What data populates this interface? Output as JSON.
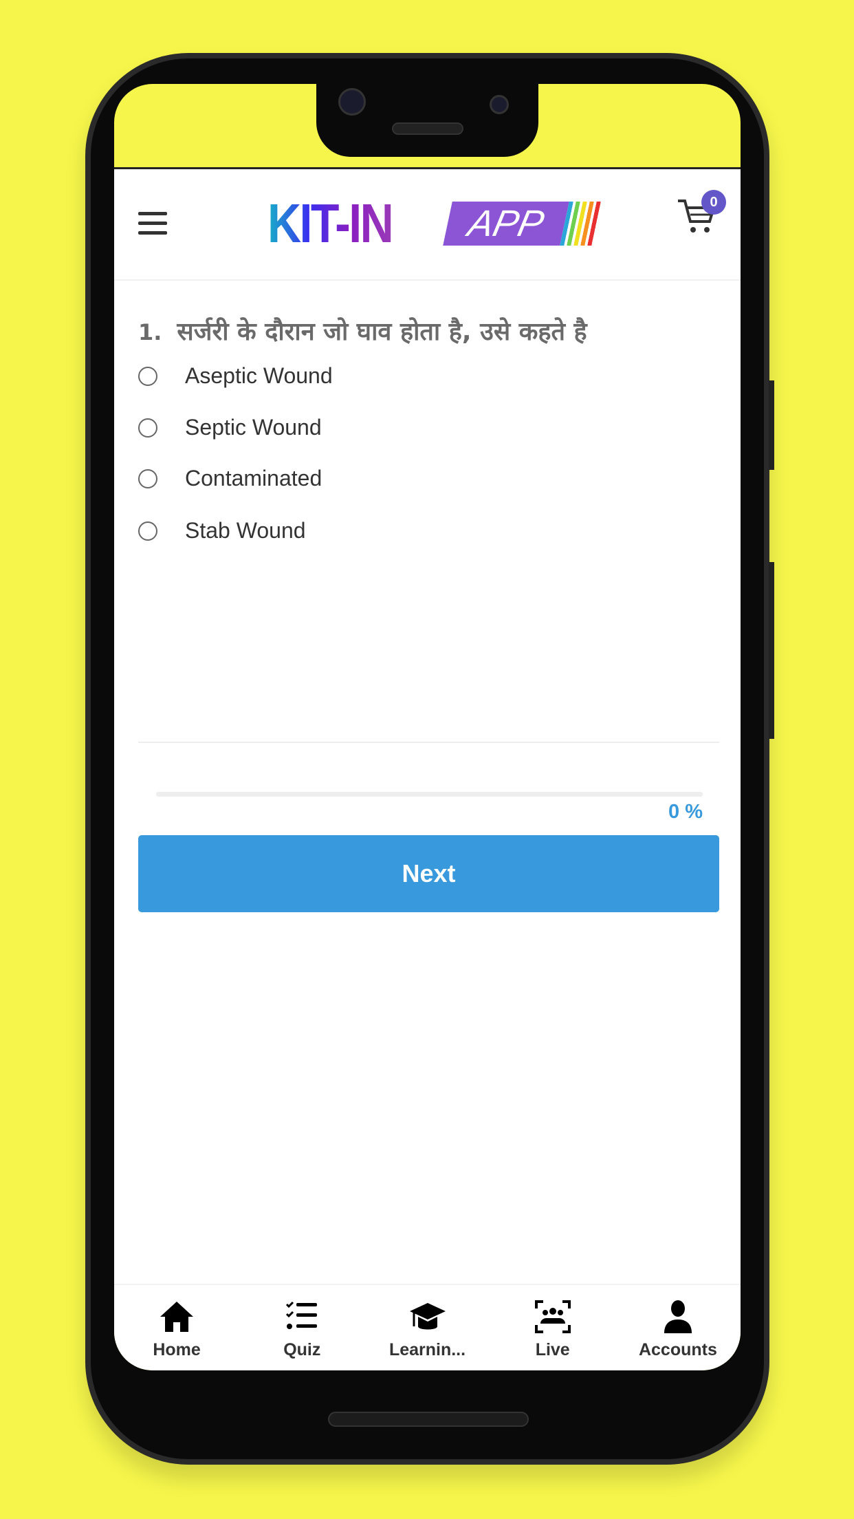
{
  "header": {
    "logo_text": "KIT-IN",
    "logo_badge": "APP",
    "cart_count": "0"
  },
  "quiz": {
    "question_number": "1.",
    "question": "सर्जरी के दौरान जो घाव होता है, उसे कहते है",
    "options": [
      {
        "label": "Aseptic Wound"
      },
      {
        "label": "Septic Wound"
      },
      {
        "label": "Contaminated"
      },
      {
        "label": "Stab Wound"
      }
    ],
    "progress_percent": 0,
    "progress_label": "0 %",
    "next_label": "Next"
  },
  "nav": {
    "items": [
      {
        "label": "Home",
        "icon": "home-icon"
      },
      {
        "label": "Quiz",
        "icon": "checklist-icon"
      },
      {
        "label": "Learnin...",
        "icon": "graduation-cap-icon"
      },
      {
        "label": "Live",
        "icon": "group-focus-icon"
      },
      {
        "label": "Accounts",
        "icon": "person-icon"
      }
    ]
  },
  "colors": {
    "background": "#f5f54b",
    "accent": "#3899dc",
    "badge": "#6356c8"
  }
}
